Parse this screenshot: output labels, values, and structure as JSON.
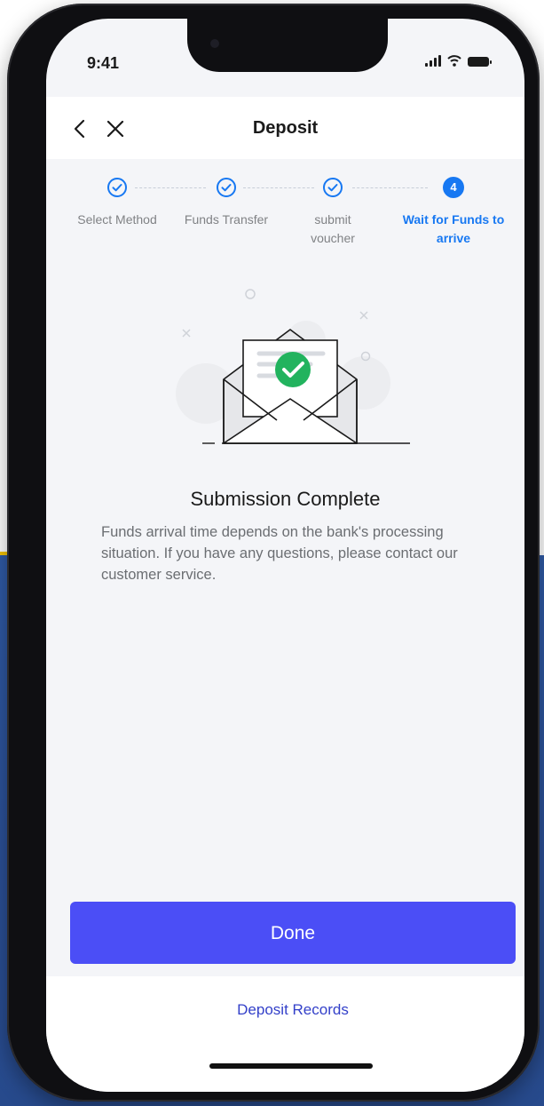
{
  "status_bar": {
    "time": "9:41"
  },
  "header": {
    "title": "Deposit",
    "back_icon": "chevron-left-icon",
    "close_icon": "close-icon"
  },
  "stepper": {
    "steps": [
      {
        "label": "Select Method",
        "state": "done",
        "icon": "check-circle-icon"
      },
      {
        "label": "Funds Transfer",
        "state": "done",
        "icon": "check-circle-icon"
      },
      {
        "label": "submit voucher",
        "state": "done",
        "icon": "check-circle-icon"
      },
      {
        "label": "Wait for Funds to arrive",
        "number": "4",
        "state": "active"
      }
    ]
  },
  "illustration": {
    "icon": "envelope-check-icon"
  },
  "result": {
    "title": "Submission Complete",
    "description": "Funds arrival time depends on the bank's processing situation. If you have any questions, please contact our customer service."
  },
  "actions": {
    "done_label": "Done",
    "records_label": "Deposit Records"
  },
  "colors": {
    "accent": "#1778f2",
    "primary_button": "#4b4ef6",
    "success": "#22b35e",
    "link": "#3340c9",
    "background": "#f4f5f8"
  }
}
